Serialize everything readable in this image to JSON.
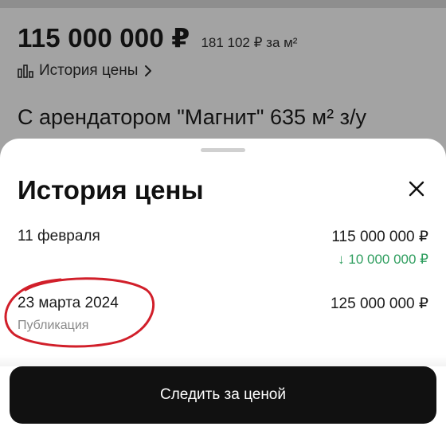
{
  "background_page": {
    "price": "115 000 000 ₽",
    "price_per_m2": "181 102 ₽ за м²",
    "history_link_label": "История цены",
    "listing_title": "С арендатором \"Магнит\" 635 м² з/у"
  },
  "price_history_sheet": {
    "title": "История цены",
    "close_icon": "close-icon",
    "entries": [
      {
        "date": "11 февраля",
        "price": "115 000 000 ₽",
        "change": "↓ 10 000 000 ₽",
        "change_color": "#2f9e5f"
      },
      {
        "date": "23 марта 2024",
        "subtitle": "Публикация",
        "price": "125 000 000 ₽"
      }
    ],
    "follow_button_label": "Следить за ценой"
  },
  "colors": {
    "overlay_background": "#a3a3a3",
    "sheet_background": "#ffffff",
    "button_background": "#111111",
    "annotation_circle": "#d11f2a",
    "price_drop": "#2f9e5f"
  }
}
